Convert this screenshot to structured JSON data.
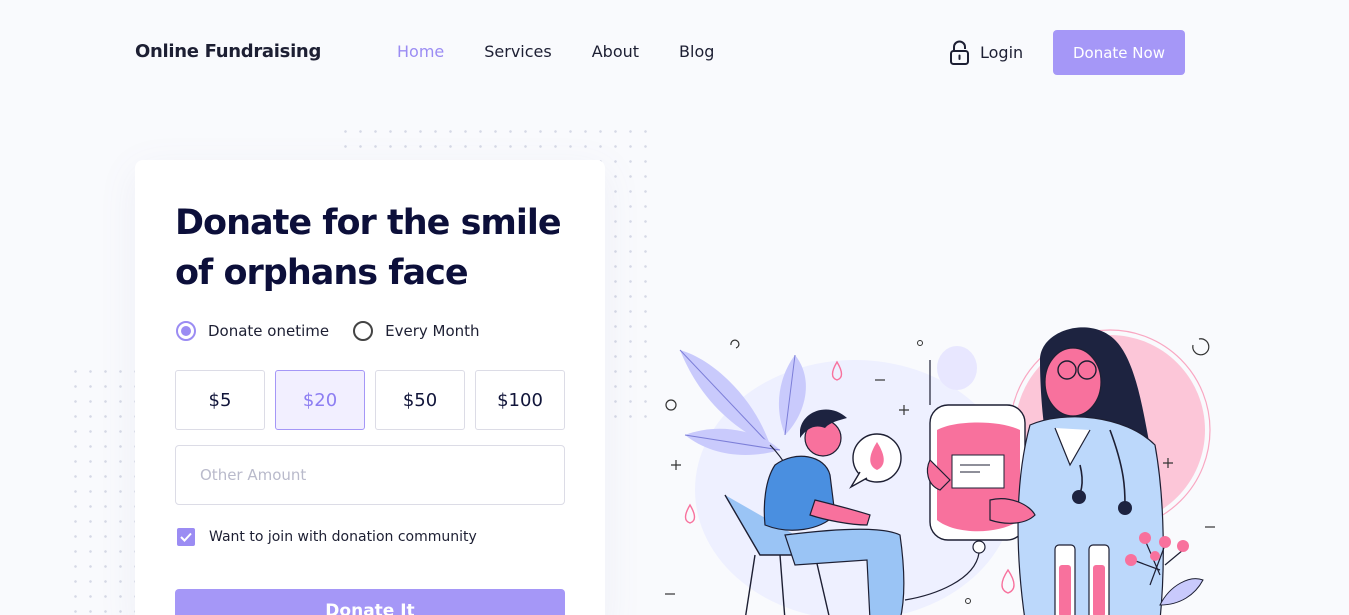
{
  "header": {
    "brand": "Online Fundraising",
    "nav": [
      {
        "label": "Home",
        "active": true
      },
      {
        "label": "Services",
        "active": false
      },
      {
        "label": "About",
        "active": false
      },
      {
        "label": "Blog",
        "active": false
      }
    ],
    "login_label": "Login",
    "login_icon": "lock-icon",
    "cta_label": "Donate Now"
  },
  "form": {
    "title": "Donate for the smile of orphans face",
    "frequency": [
      {
        "label": "Donate onetime",
        "selected": true
      },
      {
        "label": "Every Month",
        "selected": false
      }
    ],
    "amounts": [
      {
        "label": "$5",
        "selected": false
      },
      {
        "label": "$20",
        "selected": true
      },
      {
        "label": "$50",
        "selected": false
      },
      {
        "label": "$100",
        "selected": false
      }
    ],
    "other_placeholder": "Other Amount",
    "community_label": "Want to join with donation community",
    "community_checked": true,
    "submit_label": "Donate It"
  },
  "colors": {
    "accent": "#a597f7",
    "accent_text": "#9b8cf3",
    "title": "#0c0f3a",
    "pink": "#f8719d",
    "blue": "#4a8fe0"
  }
}
